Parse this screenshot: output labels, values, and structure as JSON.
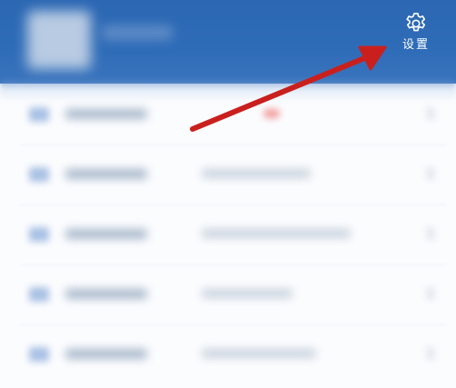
{
  "header": {
    "settings_label": "设置",
    "settings_icon": "gear-icon",
    "background_color": "#2f6cb8"
  },
  "annotation": {
    "arrow_color": "#c9201e",
    "arrow_icon": "arrow-icon"
  },
  "list": {
    "row_count": 5,
    "badge_color": "#f29a9a"
  }
}
